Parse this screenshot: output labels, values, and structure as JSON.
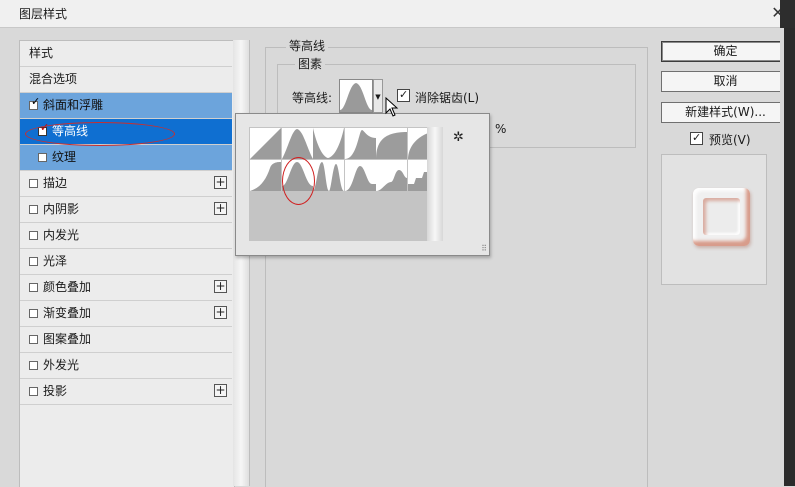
{
  "window": {
    "title": "图层样式",
    "close_glyph": "✕"
  },
  "left_list": {
    "items": [
      {
        "label": "样式",
        "checkbox": false,
        "checked": false,
        "plus": false
      },
      {
        "label": "混合选项",
        "checkbox": false,
        "checked": false,
        "plus": false
      },
      {
        "label": "斜面和浮雕",
        "checkbox": true,
        "checked": true,
        "plus": false
      },
      {
        "label": "等高线",
        "checkbox": true,
        "checked": true,
        "plus": false
      },
      {
        "label": "纹理",
        "checkbox": true,
        "checked": false,
        "plus": false
      },
      {
        "label": "描边",
        "checkbox": true,
        "checked": false,
        "plus": true
      },
      {
        "label": "内阴影",
        "checkbox": true,
        "checked": false,
        "plus": true
      },
      {
        "label": "内发光",
        "checkbox": true,
        "checked": false,
        "plus": false
      },
      {
        "label": "光泽",
        "checkbox": true,
        "checked": false,
        "plus": false
      },
      {
        "label": "颜色叠加",
        "checkbox": true,
        "checked": false,
        "plus": true
      },
      {
        "label": "渐变叠加",
        "checkbox": true,
        "checked": false,
        "plus": true
      },
      {
        "label": "图案叠加",
        "checkbox": true,
        "checked": false,
        "plus": false
      },
      {
        "label": "外发光",
        "checkbox": true,
        "checked": false,
        "plus": false
      },
      {
        "label": "投影",
        "checkbox": true,
        "checked": false,
        "plus": true
      }
    ]
  },
  "contour_panel": {
    "group_title": "等高线",
    "subgroup_title": "图素",
    "contour_label": "等高线:",
    "antialias_label": "消除锯齿(L)",
    "antialias_checked": true,
    "range_unit": "%"
  },
  "contour_picker": {
    "gear_glyph": "✲",
    "resize_glyph": "⠿",
    "presets": [
      "linear",
      "cone",
      "cone-inverted",
      "gaussian",
      "half-round",
      "ring",
      "cove-deep",
      "cove-shallow",
      "rolling-slope",
      "ring-double",
      "sawtooth",
      "rounded-steps"
    ],
    "annotated_preset": "ring"
  },
  "buttons": {
    "ok": "确定",
    "cancel": "取消",
    "new_style": "新建样式(W)..."
  },
  "preview": {
    "label": "预览(V)",
    "checked": true
  },
  "colors": {
    "section_bg": "#6ca4dc",
    "selected_bg": "#0f6fd1",
    "annotation_red": "#c83030"
  }
}
